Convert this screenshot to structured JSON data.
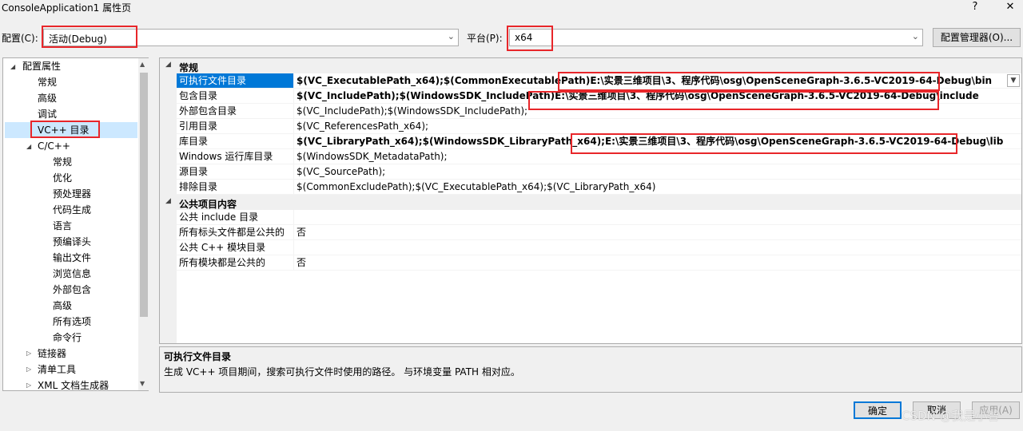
{
  "window": {
    "title": "ConsoleApplication1 属性页",
    "help": "?",
    "close": "✕"
  },
  "config": {
    "config_label": "配置(C):",
    "config_value": "活动(Debug)",
    "platform_label": "平台(P):",
    "platform_value": "x64",
    "manager_button": "配置管理器(O)..."
  },
  "tree": {
    "items": [
      "配置属性",
      "常规",
      "高级",
      "调试",
      "VC++ 目录",
      "C/C++",
      "常规",
      "优化",
      "预处理器",
      "代码生成",
      "语言",
      "预编译头",
      "输出文件",
      "浏览信息",
      "外部包含",
      "高级",
      "所有选项",
      "命令行",
      "链接器",
      "清单工具",
      "XML 文档生成器"
    ]
  },
  "grid": {
    "categories": [
      "常规",
      "公共项目内容"
    ],
    "rows": [
      {
        "name": "可执行文件目录",
        "value_bold": "$(VC_ExecutablePath_x64);$(CommonExecutablePath)",
        "value_extra": "E:\\实景三维项目\\3、程序代码\\osg\\OpenSceneGraph-3.6.5-VC2019-64-Debug\\bin"
      },
      {
        "name": "包含目录",
        "value_bold": "$(VC_IncludePath);$(WindowsSDK_IncludePath)",
        "value_extra": "E:\\实景三维项目\\3、程序代码\\osg\\OpenSceneGraph-3.6.5-VC2019-64-Debug\\include"
      },
      {
        "name": "外部包含目录",
        "value": "$(VC_IncludePath);$(WindowsSDK_IncludePath);"
      },
      {
        "name": "引用目录",
        "value": "$(VC_ReferencesPath_x64);"
      },
      {
        "name": "库目录",
        "value_bold": "$(VC_LibraryPath_x64);$(WindowsSDK_LibraryPath_x64);",
        "value_extra": "E:\\实景三维项目\\3、程序代码\\osg\\OpenSceneGraph-3.6.5-VC2019-64-Debug\\lib"
      },
      {
        "name": "Windows 运行库目录",
        "value": "$(WindowsSDK_MetadataPath);"
      },
      {
        "name": "源目录",
        "value": "$(VC_SourcePath);"
      },
      {
        "name": "排除目录",
        "value": "$(CommonExcludePath);$(VC_ExecutablePath_x64);$(VC_LibraryPath_x64)"
      },
      {
        "name": "公共 include 目录",
        "value": ""
      },
      {
        "name": "所有标头文件都是公共的",
        "value": "否"
      },
      {
        "name": "公共 C++ 模块目录",
        "value": ""
      },
      {
        "name": "所有模块都是公共的",
        "value": "否"
      }
    ]
  },
  "description": {
    "title": "可执行文件目录",
    "text": "生成 VC++ 项目期间，搜索可执行文件时使用的路径。 与环境变量 PATH 相对应。"
  },
  "buttons": {
    "ok": "确定",
    "cancel": "取消",
    "apply": "应用(A)"
  },
  "watermark": "CSDN @我是小智",
  "colors": {
    "highlight_red": "#e8262a",
    "selection_blue": "#0078d7",
    "tree_selection": "#cce8ff"
  }
}
